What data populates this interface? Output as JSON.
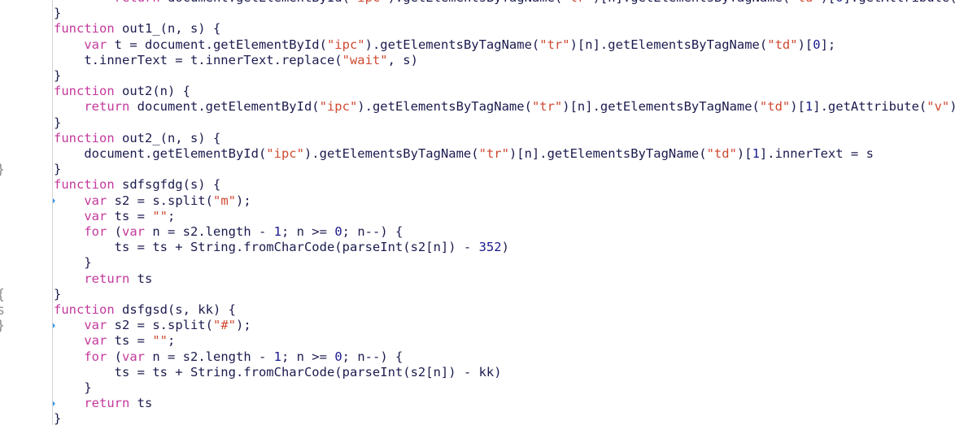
{
  "editor": {
    "name": "code-editor",
    "language": "JavaScript",
    "font_size_px": 15.5,
    "line_height_px": 19.2,
    "background": "#ffffff",
    "gutter_background": "#ffffff",
    "gutter_separator_color": "#d4d4d4",
    "line_number_color": "#8a8a8a",
    "bookmark_color": "#3d97e8",
    "bookmark_text_color": "#ffffff",
    "colors": {
      "keyword": "#c4399c",
      "string": "#cf4a32",
      "number": "#1a1a8c",
      "plain": "#1b1b4f"
    },
    "first_visible_line": 9,
    "last_visible_line": 36,
    "bookmarked_lines": [
      22,
      30,
      35
    ],
    "left_strip_glyphs": [
      "}",
      "{",
      "s",
      "}"
    ]
  },
  "lines": [
    {
      "number": "9",
      "marked": false,
      "clipped_top": true,
      "tokens": [
        {
          "t": "        ",
          "c": "pln"
        },
        {
          "t": "return",
          "c": "kw"
        },
        {
          "t": " document.getElementById(",
          "c": "pln"
        },
        {
          "t": "\"ipc\"",
          "c": "str"
        },
        {
          "t": ").getElementsByTagName(",
          "c": "pln"
        },
        {
          "t": "\"tr\"",
          "c": "str"
        },
        {
          "t": ")[n].getElementsByTagName(",
          "c": "pln"
        },
        {
          "t": "\"td\"",
          "c": "str"
        },
        {
          "t": ")[",
          "c": "pln"
        },
        {
          "t": "0",
          "c": "num"
        },
        {
          "t": "].getAttribute(",
          "c": "pln"
        },
        {
          "t": "\"v\"",
          "c": "str"
        },
        {
          "t": ")",
          "c": "pln"
        }
      ]
    },
    {
      "number": "10",
      "marked": false,
      "tokens": [
        {
          "t": "}",
          "c": "pln"
        }
      ]
    },
    {
      "number": "11",
      "marked": false,
      "tokens": [
        {
          "t": "function",
          "c": "kw"
        },
        {
          "t": " out1_(n, s) {",
          "c": "pln"
        }
      ]
    },
    {
      "number": "12",
      "marked": false,
      "tokens": [
        {
          "t": "    ",
          "c": "pln"
        },
        {
          "t": "var",
          "c": "kw"
        },
        {
          "t": " t = document.getElementById(",
          "c": "pln"
        },
        {
          "t": "\"ipc\"",
          "c": "str"
        },
        {
          "t": ").getElementsByTagName(",
          "c": "pln"
        },
        {
          "t": "\"tr\"",
          "c": "str"
        },
        {
          "t": ")[n].getElementsByTagName(",
          "c": "pln"
        },
        {
          "t": "\"td\"",
          "c": "str"
        },
        {
          "t": ")[",
          "c": "pln"
        },
        {
          "t": "0",
          "c": "num"
        },
        {
          "t": "];",
          "c": "pln"
        }
      ]
    },
    {
      "number": "13",
      "marked": false,
      "tokens": [
        {
          "t": "    t.innerText = t.innerText.replace(",
          "c": "pln"
        },
        {
          "t": "\"wait\"",
          "c": "str"
        },
        {
          "t": ", s)",
          "c": "pln"
        }
      ]
    },
    {
      "number": "14",
      "marked": false,
      "tokens": [
        {
          "t": "}",
          "c": "pln"
        }
      ]
    },
    {
      "number": "15",
      "marked": false,
      "tokens": [
        {
          "t": "function",
          "c": "kw"
        },
        {
          "t": " out2(n) {",
          "c": "pln"
        }
      ]
    },
    {
      "number": "16",
      "marked": false,
      "tokens": [
        {
          "t": "    ",
          "c": "pln"
        },
        {
          "t": "return",
          "c": "kw"
        },
        {
          "t": " document.getElementById(",
          "c": "pln"
        },
        {
          "t": "\"ipc\"",
          "c": "str"
        },
        {
          "t": ").getElementsByTagName(",
          "c": "pln"
        },
        {
          "t": "\"tr\"",
          "c": "str"
        },
        {
          "t": ")[n].getElementsByTagName(",
          "c": "pln"
        },
        {
          "t": "\"td\"",
          "c": "str"
        },
        {
          "t": ")[",
          "c": "pln"
        },
        {
          "t": "1",
          "c": "num"
        },
        {
          "t": "].getAttribute(",
          "c": "pln"
        },
        {
          "t": "\"v\"",
          "c": "str"
        },
        {
          "t": ")",
          "c": "pln"
        }
      ]
    },
    {
      "number": "17",
      "marked": false,
      "tokens": [
        {
          "t": "}",
          "c": "pln"
        }
      ]
    },
    {
      "number": "18",
      "marked": false,
      "tokens": [
        {
          "t": "function",
          "c": "kw"
        },
        {
          "t": " out2_(n, s) {",
          "c": "pln"
        }
      ]
    },
    {
      "number": "19",
      "marked": false,
      "tokens": [
        {
          "t": "    document.getElementById(",
          "c": "pln"
        },
        {
          "t": "\"ipc\"",
          "c": "str"
        },
        {
          "t": ").getElementsByTagName(",
          "c": "pln"
        },
        {
          "t": "\"tr\"",
          "c": "str"
        },
        {
          "t": ")[n].getElementsByTagName(",
          "c": "pln"
        },
        {
          "t": "\"td\"",
          "c": "str"
        },
        {
          "t": ")[",
          "c": "pln"
        },
        {
          "t": "1",
          "c": "num"
        },
        {
          "t": "].innerText = s",
          "c": "pln"
        }
      ]
    },
    {
      "number": "20",
      "marked": false,
      "tokens": [
        {
          "t": "}",
          "c": "pln"
        }
      ]
    },
    {
      "number": "21",
      "marked": false,
      "tokens": [
        {
          "t": "function",
          "c": "kw"
        },
        {
          "t": " sdfsgfdg(s) {",
          "c": "pln"
        }
      ]
    },
    {
      "number": "22",
      "marked": true,
      "tokens": [
        {
          "t": "    ",
          "c": "pln"
        },
        {
          "t": "var",
          "c": "kw"
        },
        {
          "t": " s2 = s.split(",
          "c": "pln"
        },
        {
          "t": "\"m\"",
          "c": "str"
        },
        {
          "t": ");",
          "c": "pln"
        }
      ]
    },
    {
      "number": "23",
      "marked": false,
      "tokens": [
        {
          "t": "    ",
          "c": "pln"
        },
        {
          "t": "var",
          "c": "kw"
        },
        {
          "t": " ts = ",
          "c": "pln"
        },
        {
          "t": "\"\"",
          "c": "str"
        },
        {
          "t": ";",
          "c": "pln"
        }
      ]
    },
    {
      "number": "24",
      "marked": false,
      "tokens": [
        {
          "t": "    ",
          "c": "pln"
        },
        {
          "t": "for",
          "c": "kw"
        },
        {
          "t": " (",
          "c": "pln"
        },
        {
          "t": "var",
          "c": "kw"
        },
        {
          "t": " n = s2.length - ",
          "c": "pln"
        },
        {
          "t": "1",
          "c": "num"
        },
        {
          "t": "; n >= ",
          "c": "pln"
        },
        {
          "t": "0",
          "c": "num"
        },
        {
          "t": "; n--) {",
          "c": "pln"
        }
      ]
    },
    {
      "number": "25",
      "marked": false,
      "tokens": [
        {
          "t": "        ts = ts + String.fromCharCode(parseInt(s2[n]) - ",
          "c": "pln"
        },
        {
          "t": "352",
          "c": "num"
        },
        {
          "t": ")",
          "c": "pln"
        }
      ]
    },
    {
      "number": "26",
      "marked": false,
      "tokens": [
        {
          "t": "    }",
          "c": "pln"
        }
      ]
    },
    {
      "number": "27",
      "marked": false,
      "tokens": [
        {
          "t": "    ",
          "c": "pln"
        },
        {
          "t": "return",
          "c": "kw"
        },
        {
          "t": " ts",
          "c": "pln"
        }
      ]
    },
    {
      "number": "28",
      "marked": false,
      "tokens": [
        {
          "t": "}",
          "c": "pln"
        }
      ]
    },
    {
      "number": "29",
      "marked": false,
      "tokens": [
        {
          "t": "function",
          "c": "kw"
        },
        {
          "t": " dsfgsd(s, kk) {",
          "c": "pln"
        }
      ]
    },
    {
      "number": "30",
      "marked": true,
      "tokens": [
        {
          "t": "    ",
          "c": "pln"
        },
        {
          "t": "var",
          "c": "kw"
        },
        {
          "t": " s2 = s.split(",
          "c": "pln"
        },
        {
          "t": "\"#\"",
          "c": "str"
        },
        {
          "t": ");",
          "c": "pln"
        }
      ]
    },
    {
      "number": "31",
      "marked": false,
      "tokens": [
        {
          "t": "    ",
          "c": "pln"
        },
        {
          "t": "var",
          "c": "kw"
        },
        {
          "t": " ts = ",
          "c": "pln"
        },
        {
          "t": "\"\"",
          "c": "str"
        },
        {
          "t": ";",
          "c": "pln"
        }
      ]
    },
    {
      "number": "32",
      "marked": false,
      "tokens": [
        {
          "t": "    ",
          "c": "pln"
        },
        {
          "t": "for",
          "c": "kw"
        },
        {
          "t": " (",
          "c": "pln"
        },
        {
          "t": "var",
          "c": "kw"
        },
        {
          "t": " n = s2.length - ",
          "c": "pln"
        },
        {
          "t": "1",
          "c": "num"
        },
        {
          "t": "; n >= ",
          "c": "pln"
        },
        {
          "t": "0",
          "c": "num"
        },
        {
          "t": "; n--) {",
          "c": "pln"
        }
      ]
    },
    {
      "number": "33",
      "marked": false,
      "tokens": [
        {
          "t": "        ts = ts + String.fromCharCode(parseInt(s2[n]) - kk)",
          "c": "pln"
        }
      ]
    },
    {
      "number": "34",
      "marked": false,
      "tokens": [
        {
          "t": "    }",
          "c": "pln"
        }
      ]
    },
    {
      "number": "35",
      "marked": true,
      "tokens": [
        {
          "t": "    ",
          "c": "pln"
        },
        {
          "t": "return",
          "c": "kw"
        },
        {
          "t": " ts",
          "c": "pln"
        }
      ]
    },
    {
      "number": "36",
      "marked": false,
      "clipped_bottom": true,
      "tokens": [
        {
          "t": "}",
          "c": "pln"
        }
      ]
    }
  ]
}
